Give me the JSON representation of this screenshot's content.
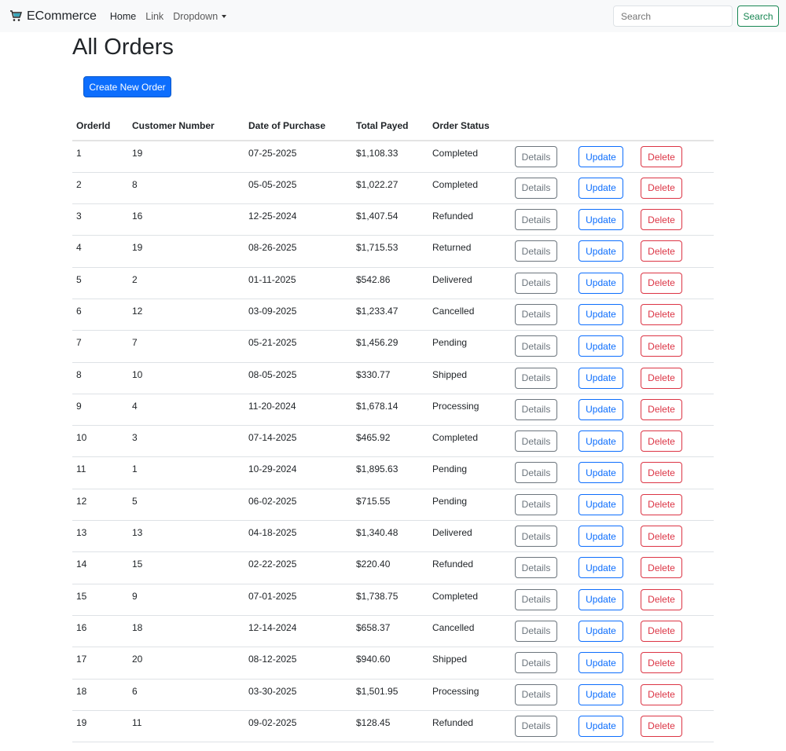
{
  "navbar": {
    "brand": "ECommerce",
    "links": [
      "Home",
      "Link",
      "Dropdown"
    ],
    "search_placeholder": "Search",
    "search_button": "Search"
  },
  "page": {
    "title": "All Orders",
    "create_button": "Create New Order"
  },
  "table": {
    "headers": [
      "OrderId",
      "Customer Number",
      "Date of Purchase",
      "Total Payed",
      "Order Status"
    ],
    "actions": {
      "details": "Details",
      "update": "Update",
      "delete": "Delete"
    },
    "rows": [
      [
        "1",
        "19",
        "07-25-2025",
        "$1,108.33",
        "Completed"
      ],
      [
        "2",
        "8",
        "05-05-2025",
        "$1,022.27",
        "Completed"
      ],
      [
        "3",
        "16",
        "12-25-2024",
        "$1,407.54",
        "Refunded"
      ],
      [
        "4",
        "19",
        "08-26-2025",
        "$1,715.53",
        "Returned"
      ],
      [
        "5",
        "2",
        "01-11-2025",
        "$542.86",
        "Delivered"
      ],
      [
        "6",
        "12",
        "03-09-2025",
        "$1,233.47",
        "Cancelled"
      ],
      [
        "7",
        "7",
        "05-21-2025",
        "$1,456.29",
        "Pending"
      ],
      [
        "8",
        "10",
        "08-05-2025",
        "$330.77",
        "Shipped"
      ],
      [
        "9",
        "4",
        "11-20-2024",
        "$1,678.14",
        "Processing"
      ],
      [
        "10",
        "3",
        "07-14-2025",
        "$465.92",
        "Completed"
      ],
      [
        "11",
        "1",
        "10-29-2024",
        "$1,895.63",
        "Pending"
      ],
      [
        "12",
        "5",
        "06-02-2025",
        "$715.55",
        "Pending"
      ],
      [
        "13",
        "13",
        "04-18-2025",
        "$1,340.48",
        "Delivered"
      ],
      [
        "14",
        "15",
        "02-22-2025",
        "$220.40",
        "Refunded"
      ],
      [
        "15",
        "9",
        "07-01-2025",
        "$1,738.75",
        "Completed"
      ],
      [
        "16",
        "18",
        "12-14-2024",
        "$658.37",
        "Cancelled"
      ],
      [
        "17",
        "20",
        "08-12-2025",
        "$940.60",
        "Shipped"
      ],
      [
        "18",
        "6",
        "03-30-2025",
        "$1,501.95",
        "Processing"
      ],
      [
        "19",
        "11",
        "09-02-2025",
        "$128.45",
        "Refunded"
      ]
    ]
  }
}
